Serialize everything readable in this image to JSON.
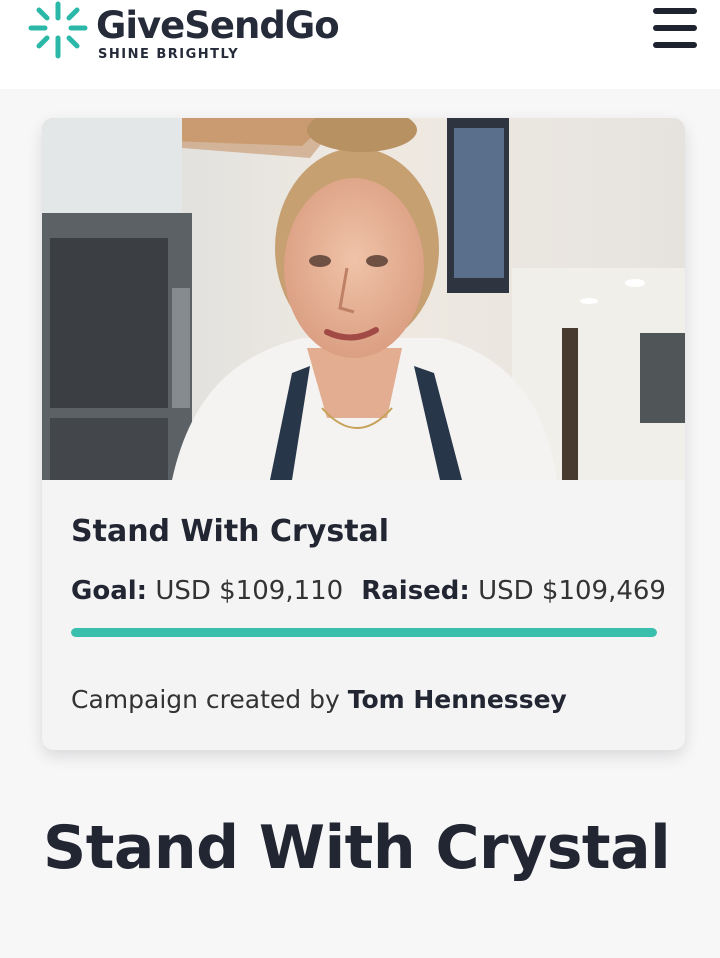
{
  "header": {
    "brand_name": "GiveSendGo",
    "tagline": "SHINE BRIGHTLY",
    "brand_color": "#2bb8a8",
    "menu_icon": "hamburger-menu-icon"
  },
  "campaign_card": {
    "image_alt": "woman in apron smiling in a kitchen",
    "title": "Stand With Crystal",
    "goal_label": "Goal:",
    "goal_value": "USD $109,110",
    "raised_label": "Raised:",
    "raised_value": "USD $109,469",
    "progress_fraction": 1.0,
    "progress_color": "#3bbfad",
    "creator_prefix": "Campaign created by",
    "creator_name": "Tom Hennessey"
  },
  "page": {
    "title": "Stand With Crystal"
  }
}
